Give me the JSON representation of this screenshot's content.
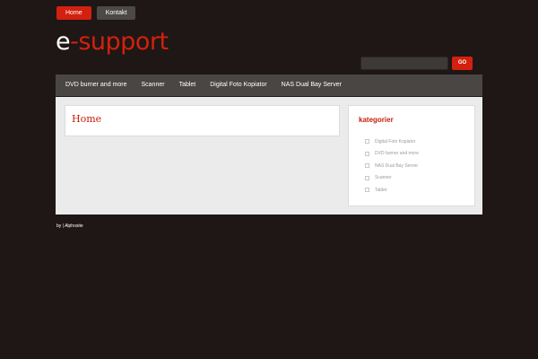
{
  "top_nav": {
    "home_label": "Home",
    "kontakt_label": "Kontakt"
  },
  "logo": {
    "prefix": "e",
    "rest": "-support"
  },
  "search": {
    "placeholder": "",
    "button_label": "GO"
  },
  "main_menu": {
    "items": [
      {
        "label": "DVD burner and more"
      },
      {
        "label": "Scanner"
      },
      {
        "label": "Tablet"
      },
      {
        "label": "Digital Foto Kopiator"
      },
      {
        "label": "NAS Dual Bay Server"
      }
    ]
  },
  "main": {
    "title": "Home"
  },
  "sidebar": {
    "title": "kategorier",
    "items": [
      {
        "label": "Digital Foto Kopiator"
      },
      {
        "label": "DVD burner and more"
      },
      {
        "label": "NAS Dual Bay Server"
      },
      {
        "label": "Scanner"
      },
      {
        "label": "Tablet"
      }
    ]
  },
  "footer": {
    "text": "by | Alphosite"
  },
  "colors": {
    "background": "#1e1715",
    "accent": "#d4200e",
    "menu_bar": "#4a4644",
    "content_bg": "#ebebeb"
  }
}
